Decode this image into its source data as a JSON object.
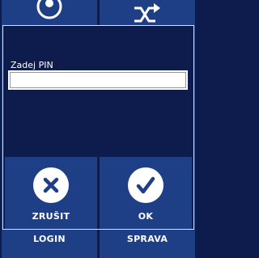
{
  "colors": {
    "background": "#0e1c4d",
    "tile": "#1e3f86",
    "text": "#ffffff",
    "border": "#dfe4f0"
  },
  "background_tiles": [
    {
      "icon": "user-circle-icon",
      "label": "LOGIN"
    },
    {
      "icon": "shuffle-icon",
      "label": "SPRAVA"
    }
  ],
  "dialog": {
    "pin_label": "Zadej PIN",
    "pin_value": "",
    "cancel_label": "ZRUŠIT",
    "cancel_icon": "close-icon",
    "ok_label": "OK",
    "ok_icon": "checkmark-icon"
  }
}
